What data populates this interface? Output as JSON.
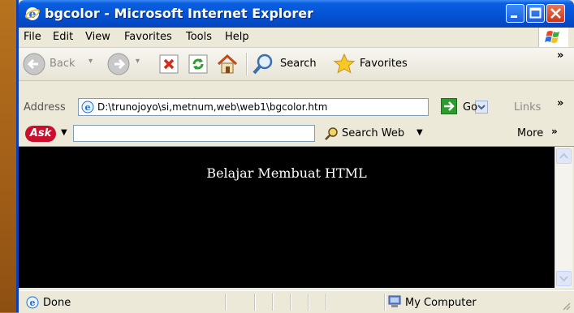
{
  "window": {
    "title": "bgcolor - Microsoft Internet Explorer"
  },
  "menu": {
    "items": [
      {
        "label": "File"
      },
      {
        "label": "Edit"
      },
      {
        "label": "View"
      },
      {
        "label": "Favorites"
      },
      {
        "label": "Tools"
      },
      {
        "label": "Help"
      }
    ]
  },
  "toolbar": {
    "back_label": "Back",
    "search_label": "Search",
    "favorites_label": "Favorites",
    "overflow": "»"
  },
  "address": {
    "label": "Address",
    "url": "D:\\trunojoyo\\si,metnum,web\\web1\\bgcolor.htm",
    "go_label": "Go",
    "links_label": "Links",
    "links_overflow": "»"
  },
  "askbar": {
    "logo": "Ask",
    "search_value": "",
    "search_web_label": "Search Web",
    "more_label": "More",
    "more_overflow": "»"
  },
  "page": {
    "heading": "Belajar Membuat HTML",
    "background_color": "#000000",
    "text_color": "#ffffff"
  },
  "status": {
    "text": "Done",
    "zone": "My Computer"
  },
  "colors": {
    "titlebar": "#0554d6",
    "chrome": "#ece9d8",
    "desktop": "#a86419"
  }
}
